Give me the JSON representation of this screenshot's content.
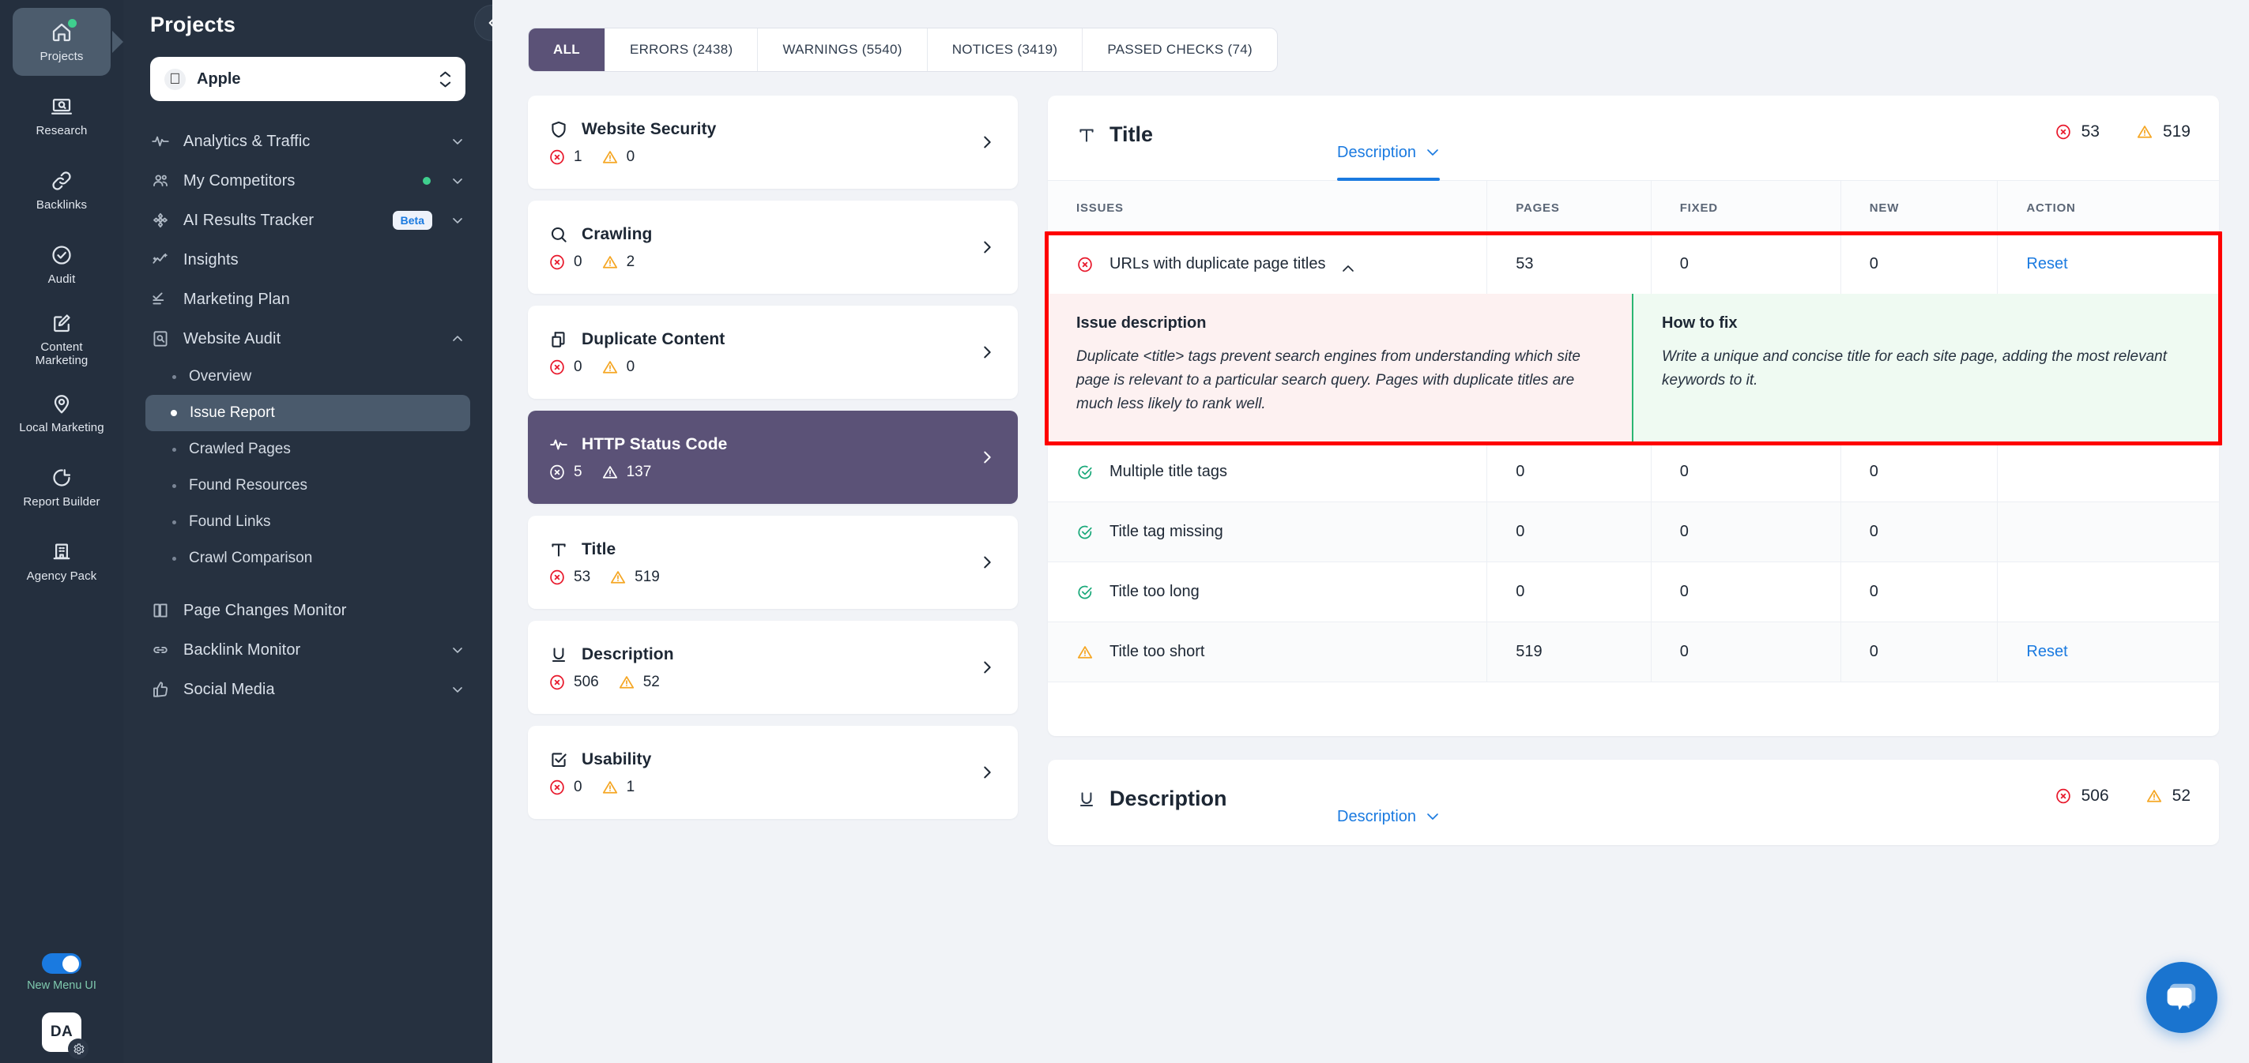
{
  "rail": {
    "items": [
      {
        "label": "Projects",
        "icon": "home-icon",
        "active": true,
        "dot": true
      },
      {
        "label": "Research",
        "icon": "laptop-search-icon",
        "active": false,
        "dot": false
      },
      {
        "label": "Backlinks",
        "icon": "link-icon",
        "active": false,
        "dot": false
      },
      {
        "label": "Audit",
        "icon": "check-circle-icon",
        "active": false,
        "dot": false
      },
      {
        "label": "Content Marketing",
        "icon": "edit-square-icon",
        "active": false,
        "dot": false
      },
      {
        "label": "Local Marketing",
        "icon": "map-pin-icon",
        "active": false,
        "dot": false
      },
      {
        "label": "Report Builder",
        "icon": "pie-chart-icon",
        "active": false,
        "dot": false
      },
      {
        "label": "Agency Pack",
        "icon": "building-icon",
        "active": false,
        "dot": false
      }
    ],
    "toggle_label": "New Menu UI",
    "toggle_on": true,
    "avatar_initials": "DA"
  },
  "sidebar": {
    "title": "Projects",
    "project": {
      "name": "Apple",
      "logo": ""
    },
    "nav": [
      {
        "label": "Analytics & Traffic",
        "icon": "pulse-icon",
        "chevron": "down",
        "dot": false,
        "badge": ""
      },
      {
        "label": "My Competitors",
        "icon": "people-icon",
        "chevron": "down",
        "dot": true,
        "badge": ""
      },
      {
        "label": "AI Results Tracker",
        "icon": "ai-icon",
        "chevron": "down",
        "dot": false,
        "badge": "Beta"
      },
      {
        "label": "Insights",
        "icon": "insights-icon",
        "chevron": "",
        "dot": false,
        "badge": ""
      },
      {
        "label": "Marketing Plan",
        "icon": "checklist-icon",
        "chevron": "",
        "dot": false,
        "badge": ""
      },
      {
        "label": "Website Audit",
        "icon": "audit-icon",
        "chevron": "up",
        "dot": false,
        "badge": ""
      }
    ],
    "audit_sub": [
      {
        "label": "Overview",
        "active": false
      },
      {
        "label": "Issue Report",
        "active": true
      },
      {
        "label": "Crawled Pages",
        "active": false
      },
      {
        "label": "Found Resources",
        "active": false
      },
      {
        "label": "Found Links",
        "active": false
      },
      {
        "label": "Crawl Comparison",
        "active": false
      }
    ],
    "nav_bottom": [
      {
        "label": "Page Changes Monitor",
        "icon": "book-icon",
        "chevron": "",
        "dot": false,
        "badge": ""
      },
      {
        "label": "Backlink Monitor",
        "icon": "link-icon",
        "chevron": "down",
        "dot": false,
        "badge": ""
      },
      {
        "label": "Social Media",
        "icon": "thumb-up-icon",
        "chevron": "down",
        "dot": false,
        "badge": ""
      }
    ]
  },
  "tabs": [
    {
      "label": "ALL",
      "active": true
    },
    {
      "label": "ERRORS (2438)",
      "active": false
    },
    {
      "label": "WARNINGS (5540)",
      "active": false
    },
    {
      "label": "NOTICES (3419)",
      "active": false
    },
    {
      "label": "PASSED CHECKS (74)",
      "active": false
    }
  ],
  "categories": [
    {
      "name": "Website Security",
      "icon": "shield-icon",
      "errors": "1",
      "warnings": "0",
      "selected": false
    },
    {
      "name": "Crawling",
      "icon": "search-icon",
      "errors": "0",
      "warnings": "2",
      "selected": false
    },
    {
      "name": "Duplicate Content",
      "icon": "copy-icon",
      "errors": "0",
      "warnings": "0",
      "selected": false
    },
    {
      "name": "HTTP Status Code",
      "icon": "pulse-icon",
      "errors": "5",
      "warnings": "137",
      "selected": true
    },
    {
      "name": "Title",
      "icon": "title-t-icon",
      "errors": "53",
      "warnings": "519",
      "selected": false
    },
    {
      "name": "Description",
      "icon": "underline-u-icon",
      "errors": "506",
      "warnings": "52",
      "selected": false
    },
    {
      "name": "Usability",
      "icon": "checkbox-icon",
      "errors": "0",
      "warnings": "1",
      "selected": false
    }
  ],
  "panel": {
    "icon": "title-t-icon",
    "title": "Title",
    "dropdown_label": "Description",
    "errors": "53",
    "warnings": "519",
    "columns": [
      "ISSUES",
      "PAGES",
      "FIXED",
      "NEW",
      "ACTION"
    ],
    "expanded": {
      "status": "error",
      "name": "URLs with duplicate page titles",
      "pages": "53",
      "fixed": "0",
      "new": "0",
      "action": "Reset",
      "issue_heading": "Issue description",
      "issue_text": "Duplicate <title> tags prevent search engines from understanding which site page is relevant to a particular search query. Pages with duplicate titles are much less likely to rank well.",
      "fix_heading": "How to fix",
      "fix_text": "Write a unique and concise title for each site page, adding the most relevant keywords to it."
    },
    "rows": [
      {
        "status": "ok",
        "name": "Multiple title tags",
        "pages": "0",
        "fixed": "0",
        "new": "0",
        "action": ""
      },
      {
        "status": "ok",
        "name": "Title tag missing",
        "pages": "0",
        "fixed": "0",
        "new": "0",
        "action": ""
      },
      {
        "status": "ok",
        "name": "Title too long",
        "pages": "0",
        "fixed": "0",
        "new": "0",
        "action": ""
      },
      {
        "status": "warn",
        "name": "Title too short",
        "pages": "519",
        "fixed": "0",
        "new": "0",
        "action": "Reset"
      }
    ]
  },
  "panel_next": {
    "icon": "underline-u-icon",
    "title": "Description",
    "dropdown_label": "Description",
    "errors": "506",
    "warnings": "52"
  },
  "chat": {
    "icon": "chat-bubble-icon"
  },
  "colors": {
    "accent_purple": "#5b5277",
    "link_blue": "#1a7ae0",
    "error_red": "#e8192c",
    "warn_orange": "#f5a623",
    "ok_green": "#1aa97a",
    "highlight_red": "#fe0000",
    "rail_bg": "#242f3e",
    "sidebar_bg": "#263140"
  }
}
